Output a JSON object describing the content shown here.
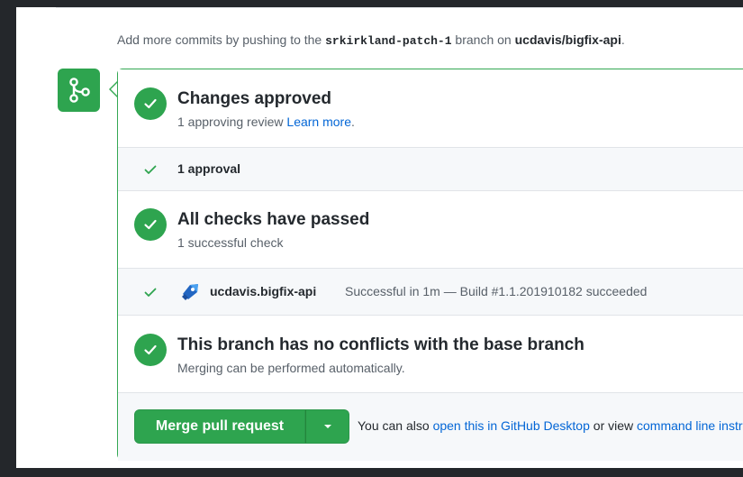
{
  "hint": {
    "prefix": "Add more commits by pushing to the ",
    "branch": "srkirkland-patch-1",
    "middle": " branch on ",
    "repo": "ucdavis/bigfix-api",
    "suffix": "."
  },
  "review": {
    "title": "Changes approved",
    "subtitle": "1 approving review ",
    "link": "Learn more",
    "link_suffix": ".",
    "approval_count": "1 approval"
  },
  "checks": {
    "title": "All checks have passed",
    "subtitle": "1 successful check",
    "check_name": "ucdavis.bigfix-api",
    "check_status": "Successful in 1m — Build #1.1.201910182 succeeded"
  },
  "conflicts": {
    "title": "This branch has no conflicts with the base branch",
    "subtitle": "Merging can be performed automatically."
  },
  "merge": {
    "button_label": "Merge pull request",
    "footer_prefix": "You can also ",
    "desktop_link": "open this in GitHub Desktop",
    "footer_middle": " or view ",
    "cli_link": "command line instructions"
  },
  "colors": {
    "success": "#2ea44f",
    "link": "#0366d6"
  }
}
